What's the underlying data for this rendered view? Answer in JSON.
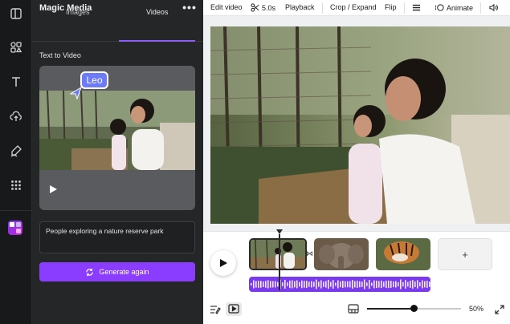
{
  "rail": {
    "items": [
      "layout-icon",
      "elements-icon",
      "text-icon",
      "uploads-icon",
      "draw-icon",
      "apps-icon"
    ],
    "active_app": "magic-media-app-icon"
  },
  "panel": {
    "title": "Magic Media",
    "more": "•••",
    "tabs": [
      {
        "label": "Images",
        "active": false
      },
      {
        "label": "Videos",
        "active": true
      }
    ],
    "section_label": "Text to Video",
    "collaborator_tag": "Leo",
    "prompt_text": "People exploring a nature reserve park",
    "generate_label": "Generate again",
    "accent": "#8b3dff"
  },
  "toolbar": {
    "edit_video": "Edit video",
    "duration": "5.0s",
    "playback": "Playback",
    "crop_expand": "Crop / Expand",
    "flip": "Flip",
    "animate": "Animate"
  },
  "timeline": {
    "clips": [
      "clip-girls-nature-park",
      "clip-elephant",
      "clip-tiger"
    ],
    "add_label": "+",
    "zoom_label": "50%",
    "zoom_level": 0.5
  }
}
